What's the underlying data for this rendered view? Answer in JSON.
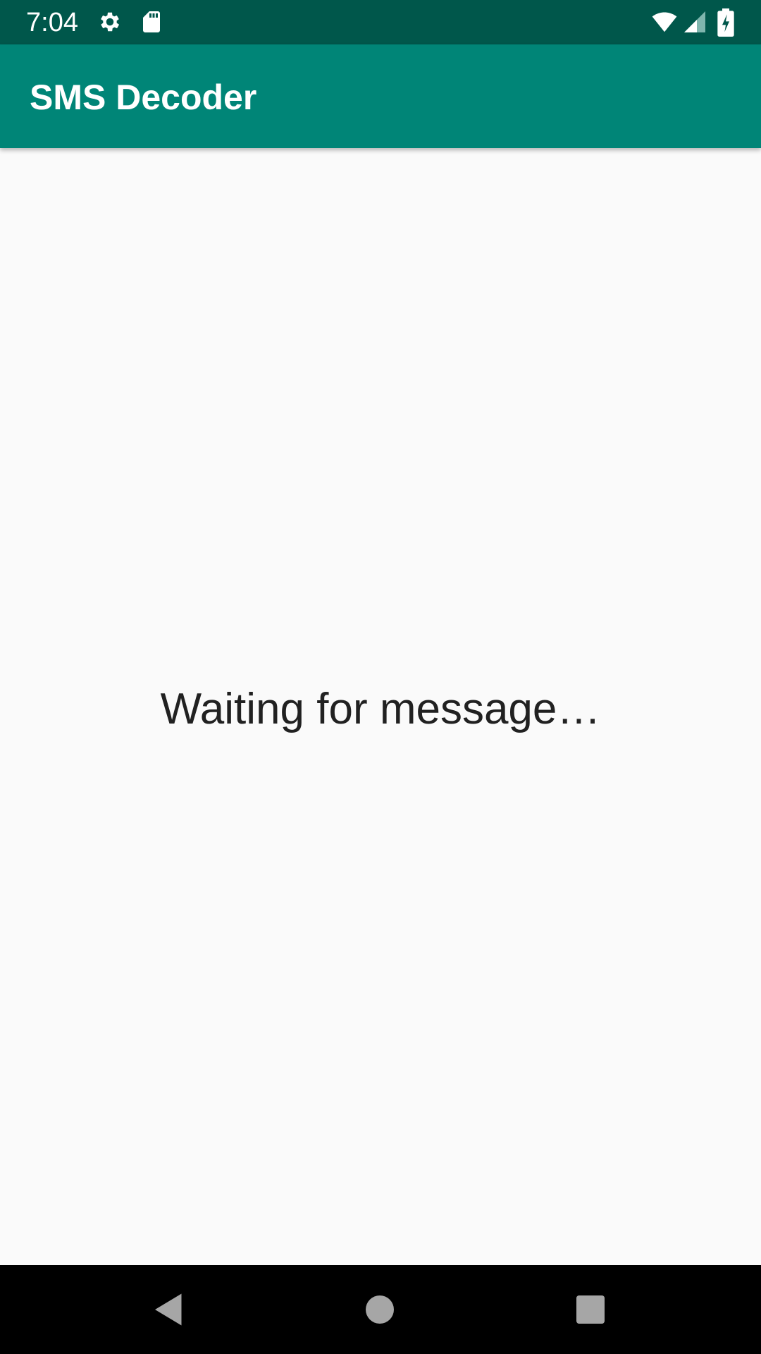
{
  "status_bar": {
    "time": "7:04",
    "icons": [
      "gear-icon",
      "sd-card-icon",
      "wifi-icon",
      "cell-signal-icon",
      "battery-charging-icon"
    ],
    "background": "#00574b"
  },
  "app_bar": {
    "title": "SMS Decoder",
    "background": "#008577"
  },
  "main": {
    "status_text": "Waiting for message…"
  },
  "nav_bar": {
    "buttons": [
      "back-icon",
      "home-icon",
      "recents-icon"
    ]
  }
}
